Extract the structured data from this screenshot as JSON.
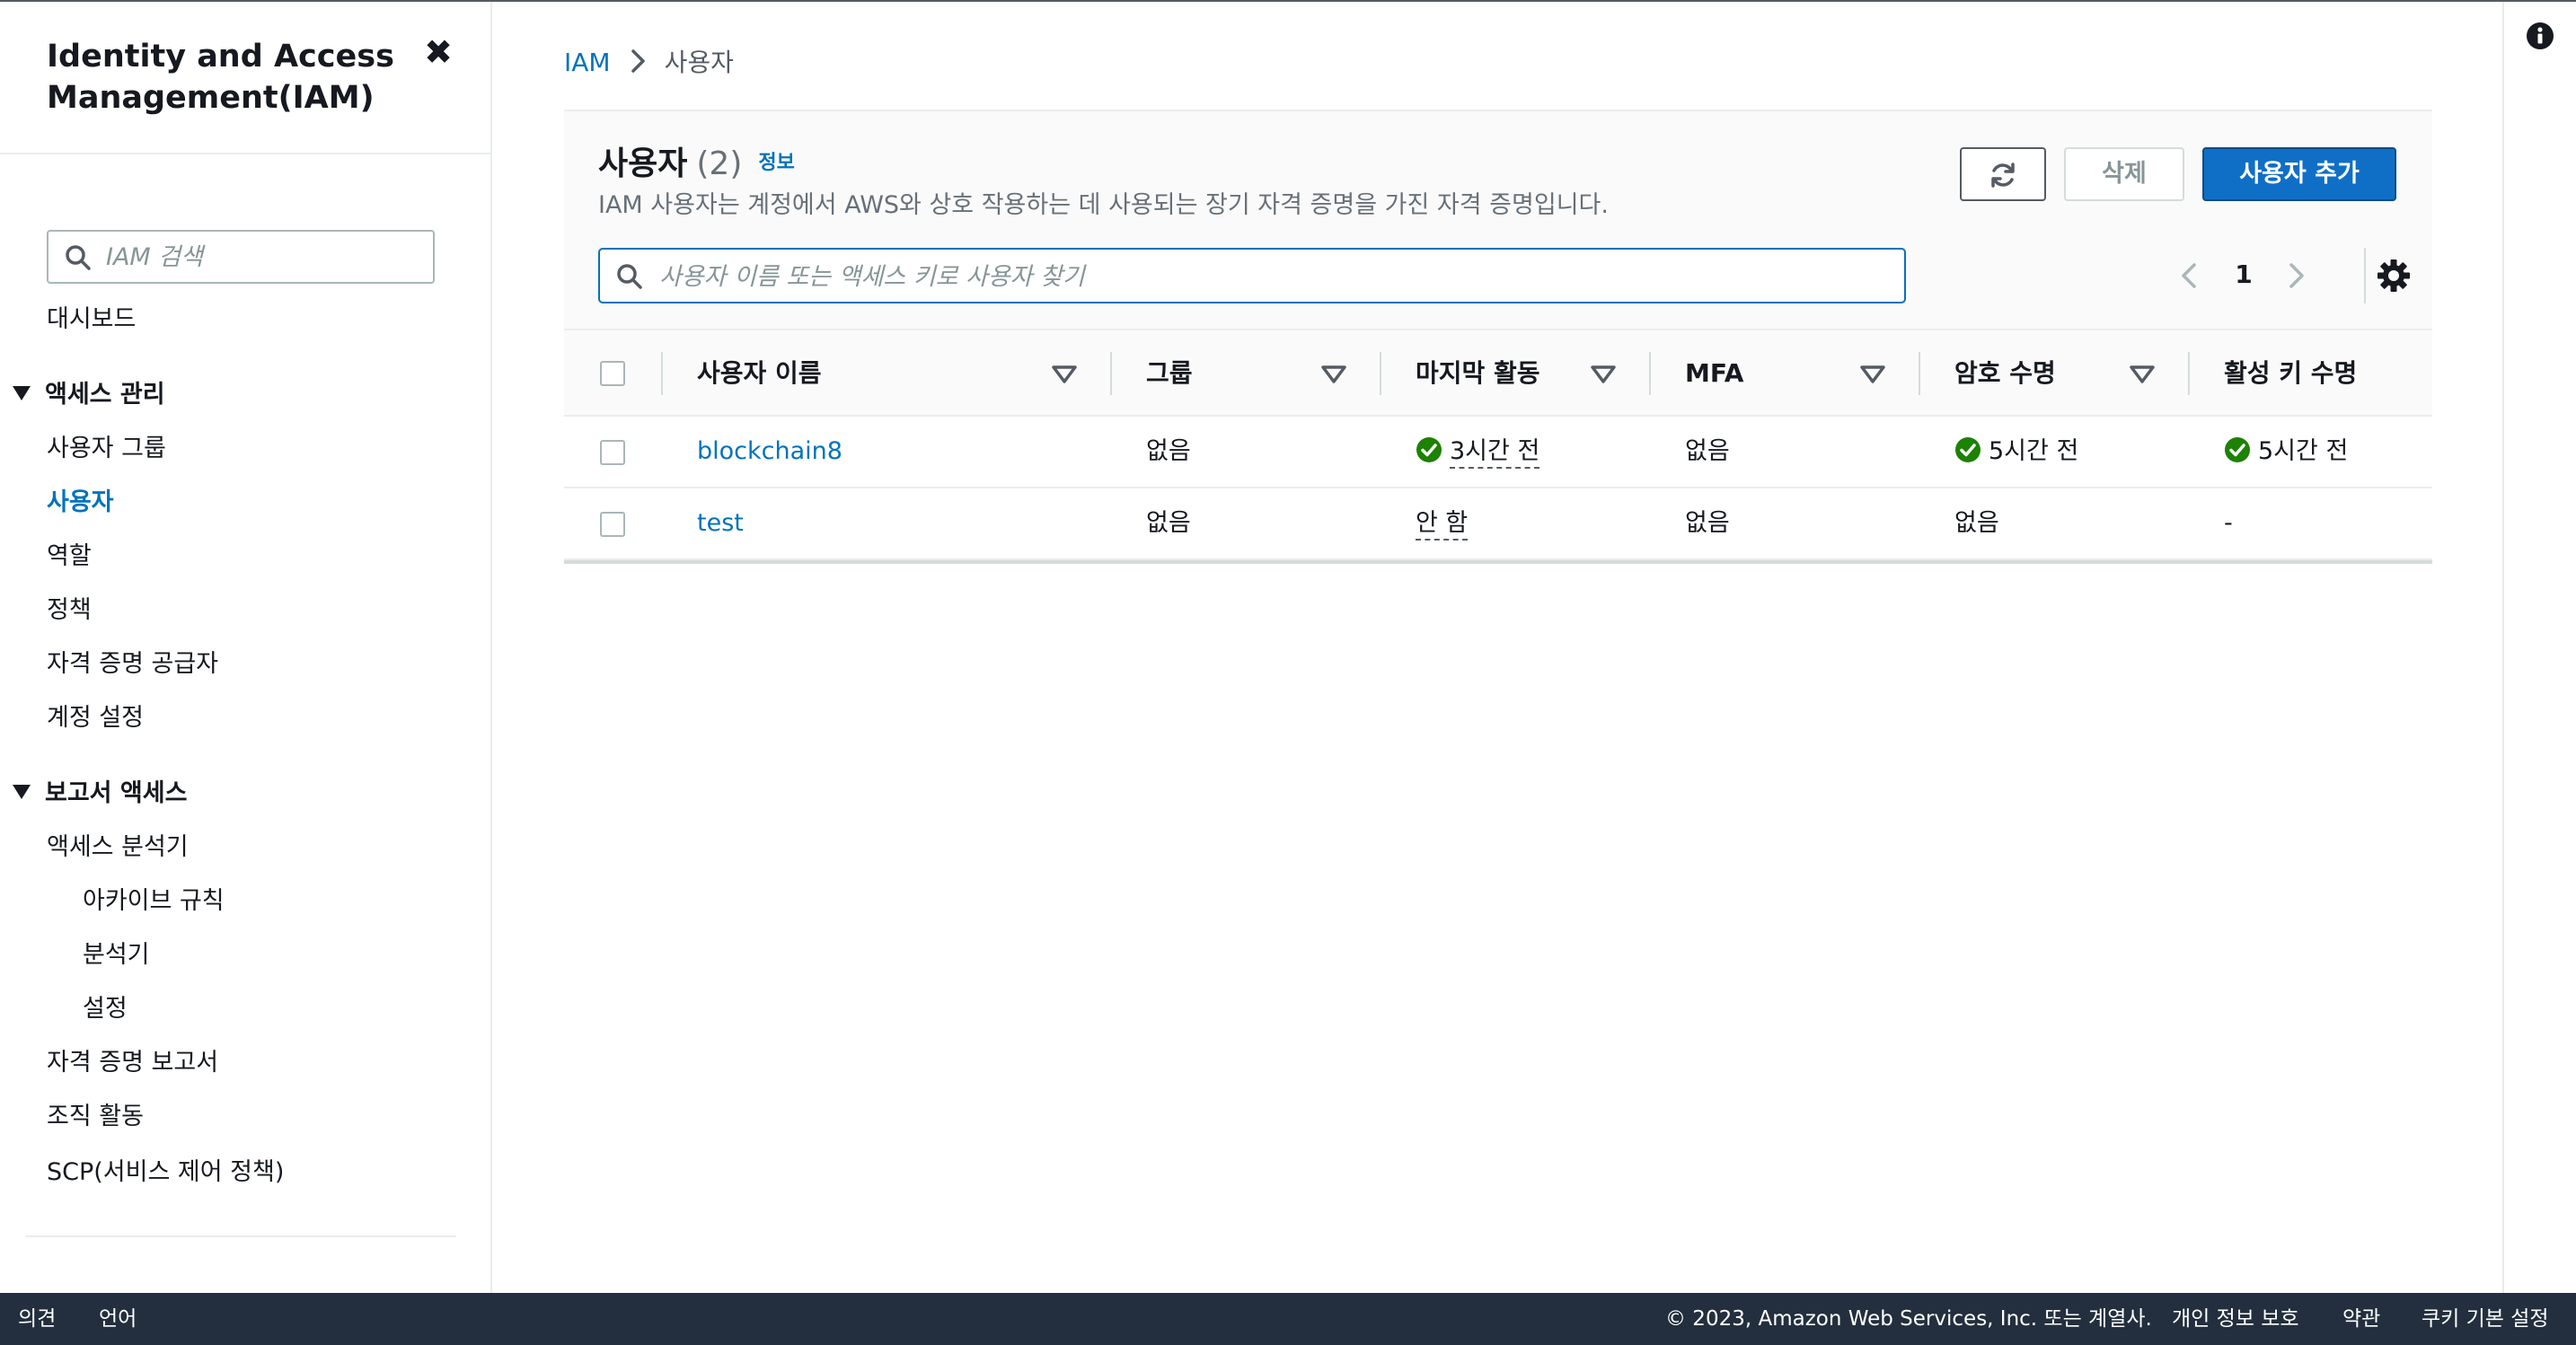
{
  "sidebar": {
    "title_line1": "Identity and Access",
    "title_line2": "Management(IAM)",
    "close_glyph": "✖",
    "search_placeholder": "IAM 검색",
    "dashboard": "대시보드",
    "section_access": "액세스 관리",
    "access_items": [
      "사용자 그룹",
      "사용자",
      "역할",
      "정책",
      "자격 증명 공급자",
      "계정 설정"
    ],
    "active_item": "사용자",
    "section_reports": "보고서 액세스",
    "report_items": [
      "액세스 분석기",
      "아카이브 규칙",
      "분석기",
      "설정",
      "자격 증명 보고서",
      "조직 활동",
      "SCP(서비스 제어 정책)"
    ]
  },
  "breadcrumb": {
    "root": "IAM",
    "current": "사용자"
  },
  "panel": {
    "title": "사용자",
    "count": "(2)",
    "info_link": "정보",
    "description": "IAM 사용자는 계정에서 AWS와 상호 작용하는 데 사용되는 장기 자격 증명을 가진 자격 증명입니다.",
    "delete_label": "삭제",
    "add_label": "사용자 추가",
    "search_placeholder": "사용자 이름 또는 액세스 키로 사용자 찾기",
    "page_number": "1"
  },
  "table": {
    "columns": [
      "사용자 이름",
      "그룹",
      "마지막 활동",
      "MFA",
      "암호 수명",
      "활성 키 수명"
    ],
    "rows": [
      {
        "name": "blockchain8",
        "group": "없음",
        "last_activity": "3시간 전",
        "mfa": "없음",
        "password_age": "5시간 전",
        "key_age": "5시간 전"
      },
      {
        "name": "test",
        "group": "없음",
        "last_activity": "안 함",
        "mfa": "없음",
        "password_age": "없음",
        "key_age": "-"
      }
    ]
  },
  "footer": {
    "feedback": "의견",
    "language": "언어",
    "copyright": "© 2023, Amazon Web Services, Inc. 또는 계열사.",
    "privacy": "개인 정보 보호",
    "terms": "약관",
    "cookies": "쿠키 기본 설정"
  },
  "colors": {
    "link": "#0073bb",
    "primary_button": "#0f6fc6",
    "success": "#1d8102",
    "footer_bg": "#232f3e"
  }
}
